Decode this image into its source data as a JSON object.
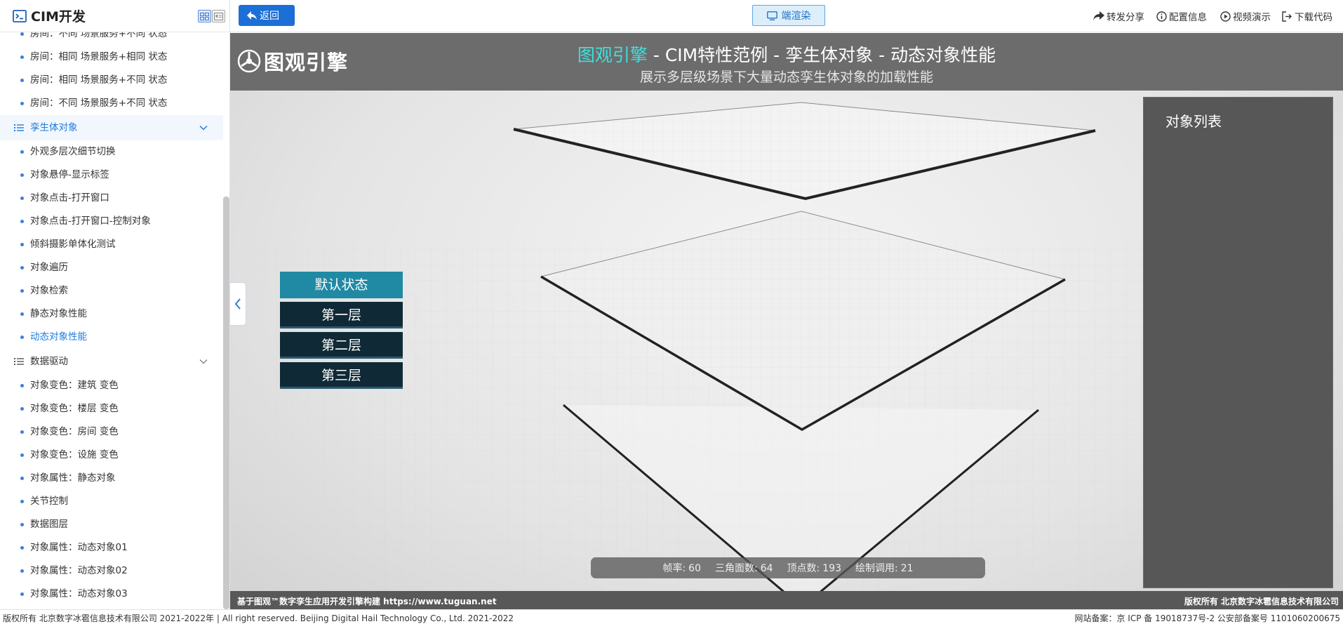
{
  "app": {
    "title": "CIM开发"
  },
  "sidebar": {
    "items": [
      {
        "type": "item",
        "label": "房间：不同 场景服务+不同 状态"
      },
      {
        "type": "item",
        "label": "房间：相同 场景服务+相同 状态"
      },
      {
        "type": "item",
        "label": "房间：相同 场景服务+不同 状态"
      },
      {
        "type": "item",
        "label": "房间：不同 场景服务+不同 状态"
      },
      {
        "type": "group",
        "label": "孪生体对象",
        "open": true
      },
      {
        "type": "item",
        "label": "外观多层次细节切换"
      },
      {
        "type": "item",
        "label": "对象悬停-显示标签"
      },
      {
        "type": "item",
        "label": "对象点击-打开窗口"
      },
      {
        "type": "item",
        "label": "对象点击-打开窗口-控制对象"
      },
      {
        "type": "item",
        "label": "倾斜摄影单体化测试"
      },
      {
        "type": "item",
        "label": "对象遍历"
      },
      {
        "type": "item",
        "label": "对象检索"
      },
      {
        "type": "item",
        "label": "静态对象性能"
      },
      {
        "type": "item",
        "label": "动态对象性能",
        "active": true
      },
      {
        "type": "group",
        "label": "数据驱动",
        "open": false
      },
      {
        "type": "item",
        "label": "对象变色：建筑 变色"
      },
      {
        "type": "item",
        "label": "对象变色：楼层 变色"
      },
      {
        "type": "item",
        "label": "对象变色：房间 变色"
      },
      {
        "type": "item",
        "label": "对象变色：设施 变色"
      },
      {
        "type": "item",
        "label": "对象属性：静态对象"
      },
      {
        "type": "item",
        "label": "关节控制"
      },
      {
        "type": "item",
        "label": "数据图层"
      },
      {
        "type": "item",
        "label": "对象属性：动态对象01"
      },
      {
        "type": "item",
        "label": "对象属性：动态对象02"
      },
      {
        "type": "item",
        "label": "对象属性：动态对象03"
      }
    ]
  },
  "toolbar": {
    "back_label": "返回",
    "render_label": "端渲染",
    "share_label": "转发分享",
    "config_label": "配置信息",
    "video_label": "视频演示",
    "download_label": "下载代码"
  },
  "scene": {
    "brand": "图观引擎",
    "title_highlight": "图观引擎",
    "title_rest": " - CIM特性范例 - 孪生体对象 - 动态对象性能",
    "subtitle": "展示多层级场景下大量动态孪生体对象的加载性能",
    "panel_title": "对象列表",
    "layer_buttons": [
      "默认状态",
      "第一层",
      "第二层",
      "第三层"
    ],
    "active_layer": "默认状态",
    "stats": {
      "fps_label": "帧率:",
      "fps": "60",
      "tri_label": "三角面数:",
      "tri": "64",
      "vert_label": "顶点数:",
      "vert": "193",
      "draw_label": "绘制调用:",
      "draw": "21"
    },
    "credits_left": "基于图观™数字孪生应用开发引擎构建 https://www.tuguan.net",
    "credits_right": "版权所有 北京数字冰雹信息技术有限公司"
  },
  "footer": {
    "left": "版权所有 北京数字冰雹信息技术有限公司 2021-2022年 | All right reserved. Beijing Digital Hail Technology Co., Ltd. 2021-2022",
    "right": "网站备案：京 ICP 备 19018737号-2 公安部备案号 11010602006​75"
  },
  "colors": {
    "accent": "#1c6fd6",
    "title_highlight": "#3ee0dc",
    "layer_active": "#2089a3",
    "layer_inactive": "#0f2a36"
  }
}
